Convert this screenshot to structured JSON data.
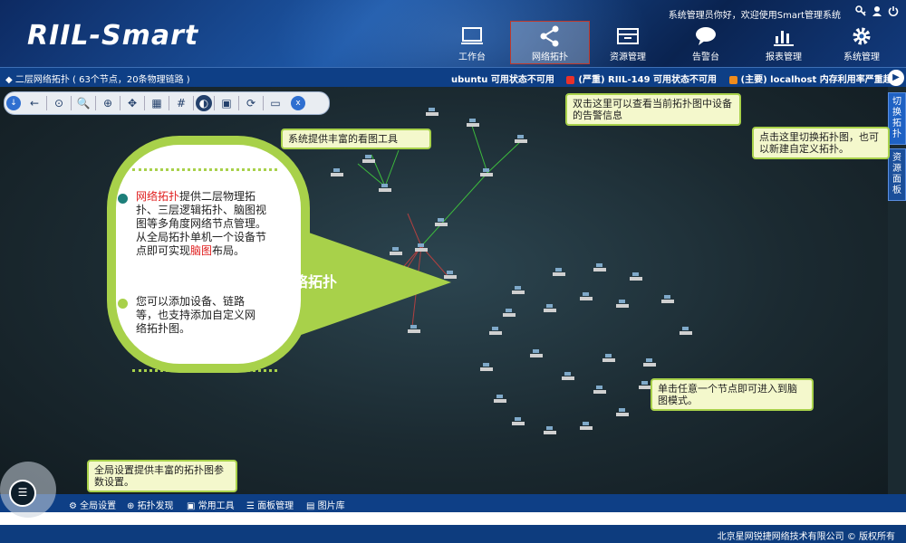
{
  "header": {
    "logo": "RIIL-Smart",
    "welcome": "系统管理员你好，欢迎使用Smart管理系统",
    "nav": [
      {
        "label": "工作台",
        "icon": "monitor-icon"
      },
      {
        "label": "网络拓扑",
        "icon": "share-icon",
        "active": true
      },
      {
        "label": "资源管理",
        "icon": "inbox-icon"
      },
      {
        "label": "告警台",
        "icon": "chat-icon"
      },
      {
        "label": "报表管理",
        "icon": "bar-chart-icon"
      },
      {
        "label": "系统管理",
        "icon": "gear-icon"
      }
    ]
  },
  "subbar": {
    "breadcrumb": "二层网络拓扑 ( 63个节点，20条物理链路 )",
    "ticker": [
      {
        "text": "ubuntu 可用状态不可用",
        "color": ""
      },
      {
        "text": "(严重) RIIL-149 可用状态不可用",
        "color": "#e8312a"
      },
      {
        "text": "(主要) localhost 内存利用率严重超标",
        "color": "#f08c1c"
      }
    ]
  },
  "side_tabs": [
    "切换拓扑",
    "资源面板"
  ],
  "callouts": {
    "alarm": "双击这里可以查看当前拓扑图中设备的告警信息",
    "tools": "系统提供丰富的看图工具",
    "switch": "点击这里切换拓扑图，也可以新建自定义拓扑。",
    "node": "单击任意一个节点即可进入到脑图模式。",
    "settings": "全局设置提供丰富的拓扑图参数设置。"
  },
  "bubble": {
    "title": "网络拓扑",
    "p1_red": "网络拓扑",
    "p1": "提供二层物理拓扑、三层逻辑拓扑、脑图视图等多角度网络节点管理。从全局拓扑单机一个设备节点即可实现",
    "p1_red2": "脑图",
    "p1_end": "布局。",
    "p2": "您可以添加设备、链路等，也支持添加自定义网络拓扑图。"
  },
  "bottom": [
    "全局设置",
    "拓扑发现",
    "常用工具",
    "面板管理",
    "图片库"
  ],
  "footer": "北京星网锐捷网络技术有限公司 © 版权所有"
}
